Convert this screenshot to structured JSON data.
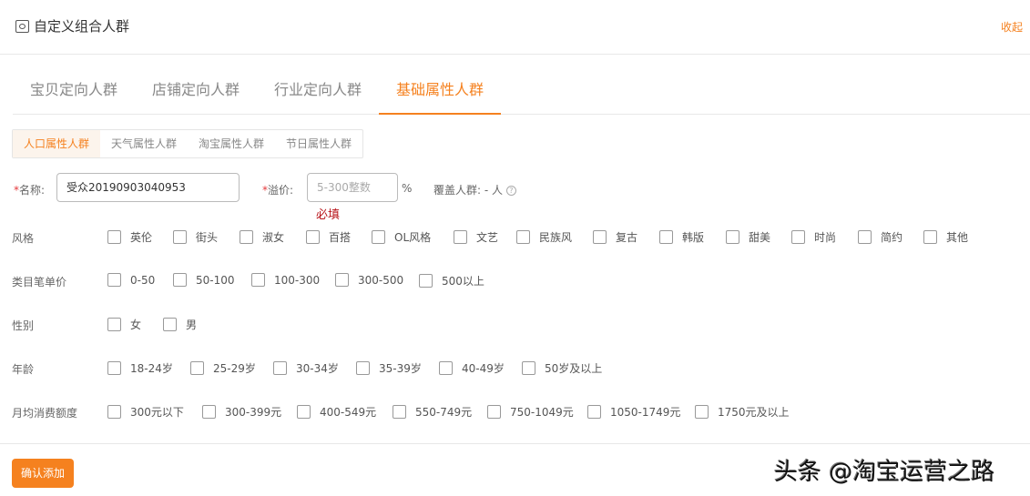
{
  "header": {
    "title": "自定义组合人群",
    "collapse": "收起"
  },
  "tabs": [
    "宝贝定向人群",
    "店铺定向人群",
    "行业定向人群",
    "基础属性人群"
  ],
  "subtabs": [
    "人口属性人群",
    "天气属性人群",
    "淘宝属性人群",
    "节日属性人群"
  ],
  "form": {
    "name_label": "名称:",
    "name_value": "受众20190903040953",
    "premium_label": "溢价:",
    "premium_placeholder": "5-300整数",
    "percent": "%",
    "required_msg": "必填",
    "coverage_label": "覆盖人群:",
    "coverage_value": "- 人",
    "help": "?",
    "star": "*"
  },
  "groups": [
    {
      "label": "风格",
      "options": [
        "英伦",
        "街头",
        "淑女",
        "百搭",
        "OL风格",
        "文艺",
        "民族风",
        "复古",
        "韩版",
        "甜美",
        "时尚",
        "简约",
        "其他"
      ]
    },
    {
      "label": "类目笔单价",
      "options": [
        "0-50",
        "50-100",
        "100-300",
        "300-500",
        "500以上"
      ]
    },
    {
      "label": "性别",
      "options": [
        "女",
        "男"
      ]
    },
    {
      "label": "年龄",
      "options": [
        "18-24岁",
        "25-29岁",
        "30-34岁",
        "35-39岁",
        "40-49岁",
        "50岁及以上"
      ]
    },
    {
      "label": "月均消费额度",
      "options": [
        "300元以下",
        "300-399元",
        "400-549元",
        "550-749元",
        "750-1049元",
        "1050-1749元",
        "1750元及以上"
      ]
    }
  ],
  "confirm": "确认添加",
  "watermark": "头条 @淘宝运营之路"
}
